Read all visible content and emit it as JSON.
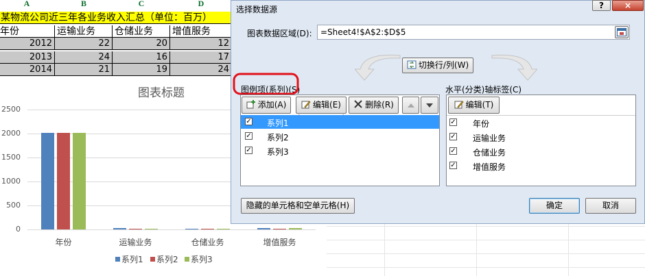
{
  "sheet": {
    "col_headers": [
      "A",
      "B",
      "C",
      "D"
    ],
    "title_row": "某物流公司近三年各业务收入汇总（单位：百万）",
    "header_row": [
      "年份",
      "运输业务",
      "仓储业务",
      "增值服务"
    ],
    "rows": [
      [
        "2012",
        "22",
        "20",
        "12"
      ],
      [
        "2013",
        "24",
        "16",
        "17"
      ],
      [
        "2014",
        "21",
        "19",
        "24"
      ]
    ]
  },
  "chart": {
    "title": "图表标题",
    "legend": [
      "系列1",
      "系列2",
      "系列3"
    ]
  },
  "chart_data": {
    "type": "bar",
    "title": "图表标题",
    "categories": [
      "年份",
      "运输业务",
      "仓储业务",
      "增值服务"
    ],
    "series": [
      {
        "name": "系列1",
        "values": [
          2012,
          22,
          21,
          24
        ]
      },
      {
        "name": "系列2",
        "values": [
          2013,
          20,
          16,
          19
        ]
      },
      {
        "name": "系列3",
        "values": [
          2014,
          12,
          17,
          24
        ]
      }
    ],
    "yticks": [
      "0",
      "500",
      "1000",
      "1500",
      "2000",
      "2500"
    ],
    "ylim": [
      0,
      2500
    ],
    "colors": [
      "#4f81bd",
      "#c0504d",
      "#9bbb59"
    ],
    "legend_position": "bottom",
    "grid": true
  },
  "dialog": {
    "title": "选择数据源",
    "help": "?",
    "close": "×",
    "range_label": "图表数据区域(D):",
    "range_value": "=Sheet4!$A$2:$D$5",
    "switch_btn": "切换行/列(W)",
    "legend_group": "图例项(系列)(S)",
    "add_btn": "添加(A)",
    "edit_btn": "编辑(E)",
    "delete_btn": "删除(R)",
    "series_items": [
      "系列1",
      "系列2",
      "系列3"
    ],
    "axis_group": "水平(分类)轴标签(C)",
    "axis_edit_btn": "编辑(T)",
    "axis_items": [
      "年份",
      "运输业务",
      "仓储业务",
      "增值服务"
    ],
    "hidden_btn": "隐藏的单元格和空单元格(H)",
    "ok_btn": "确定",
    "cancel_btn": "取消"
  }
}
